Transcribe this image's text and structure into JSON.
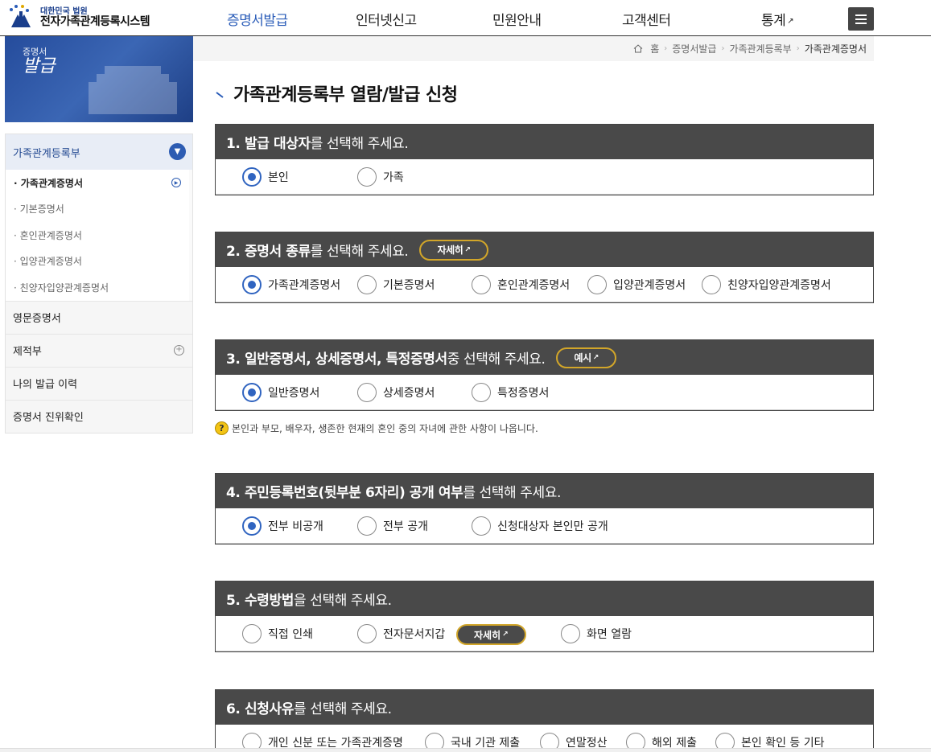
{
  "header": {
    "logo_sub": "대한민국 법원",
    "logo_main": "전자가족관계등록시스템",
    "nav": [
      {
        "label": "증명서발급"
      },
      {
        "label": "인터넷신고"
      },
      {
        "label": "민원안내"
      },
      {
        "label": "고객센터"
      },
      {
        "label": "통계"
      }
    ]
  },
  "banner": {
    "small": "증명서",
    "big": "발급"
  },
  "lnb": {
    "top": "가족관계등록부",
    "sub": [
      "· 가족관계증명서",
      "· 기본증명서",
      "· 혼인관계증명서",
      "· 입양관계증명서",
      "· 친양자입양관계증명서"
    ],
    "items": [
      "영문증명서",
      "제적부",
      "나의 발급 이력",
      "증명서 진위확인"
    ]
  },
  "breadcrumb": [
    "홈",
    "증명서발급",
    "가족관계등록부",
    "가족관계증명서"
  ],
  "page_title": "가족관계등록부 열람/발급 신청",
  "sections": {
    "s1": {
      "bold": "1. 발급 대상자",
      "light": "를 선택해 주세요.",
      "options": [
        "본인",
        "가족"
      ]
    },
    "s2": {
      "bold": "2. 증명서 종류",
      "light": "를 선택해 주세요.",
      "button": "자세히",
      "options": [
        "가족관계증명서",
        "기본증명서",
        "혼인관계증명서",
        "입양관계증명서",
        "친양자입양관계증명서"
      ]
    },
    "s3": {
      "bold": "3. 일반증명서, 상세증명서, 특정증명서",
      "light": " 중 선택해 주세요.",
      "button": "예시",
      "options": [
        "일반증명서",
        "상세증명서",
        "특정증명서"
      ]
    },
    "s4": {
      "bold": "4. 주민등록번호(뒷부분 6자리) 공개 여부",
      "light": "를 선택해 주세요.",
      "options": [
        "전부 비공개",
        "전부 공개",
        "신청대상자 본인만 공개"
      ]
    },
    "s5": {
      "bold": "5. 수령방법",
      "light": "을 선택해 주세요.",
      "button": "자세히",
      "options": [
        "직접 인쇄",
        "전자문서지갑",
        "화면 열람"
      ]
    },
    "s6": {
      "bold": "6. 신청사유",
      "light": "를 선택해 주세요.",
      "options": [
        "개인 신분 또는 가족관계증명",
        "국내 기관 제출",
        "연말정산",
        "해외 제출",
        "본인 확인 등 기타"
      ]
    }
  },
  "notice": "본인과 부모, 배우자, 생존한 현재의 혼인 중의 자녀에 관한 사항이 나옵니다.",
  "colors": {
    "accent": "#3064c0",
    "section_header": "#494949",
    "pill_border": "#d2a629"
  }
}
